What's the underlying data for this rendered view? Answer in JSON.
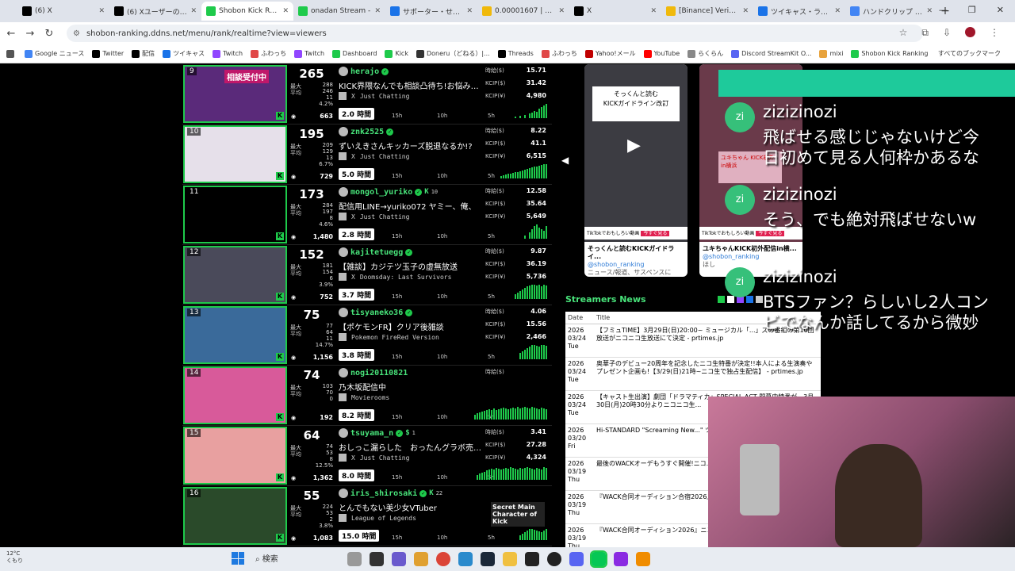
{
  "browser": {
    "tabs": [
      {
        "title": "(6) X",
        "favicon": "x-icon",
        "color": "#000000"
      },
      {
        "title": "(6) Xユーザーのにこ",
        "favicon": "x-icon",
        "color": "#000000"
      },
      {
        "title": "Shobon Kick Rank",
        "favicon": "sparkle-icon",
        "color": "#1eca4b",
        "active": true
      },
      {
        "title": "onadan Stream -",
        "favicon": "kick-icon",
        "color": "#1eca4b"
      },
      {
        "title": "サポーター・せんろ",
        "favicon": "globe-icon",
        "color": "#1a73e8"
      },
      {
        "title": "0.00001607 | AXS",
        "favicon": "coin-icon",
        "color": "#f0b90b"
      },
      {
        "title": "X",
        "favicon": "x-icon",
        "color": "#000000"
      },
      {
        "title": "[Binance] Verificati",
        "favicon": "binance-icon",
        "color": "#f0b90b"
      },
      {
        "title": "ツイキャス・ライブ",
        "favicon": "twitcasting-icon",
        "color": "#1a73e8"
      },
      {
        "title": "ハンドクリップ - Go",
        "favicon": "google-icon",
        "color": "#4285f4"
      }
    ],
    "url": "shobon-ranking.ddns.net/menu/rank/realtime?view=viewers",
    "bookmarks": [
      {
        "label": "",
        "color": "#555555"
      },
      {
        "label": "Google ニュース",
        "color": "#4285f4"
      },
      {
        "label": "Twitter",
        "color": "#000000"
      },
      {
        "label": "配信",
        "color": "#000000"
      },
      {
        "label": "ツイキャス",
        "color": "#1a73e8"
      },
      {
        "label": "Twitch",
        "color": "#9146ff"
      },
      {
        "label": "ふわっち",
        "color": "#e04848"
      },
      {
        "label": "Twitch",
        "color": "#9146ff"
      },
      {
        "label": "Dashboard",
        "color": "#1eca4b"
      },
      {
        "label": "Kick",
        "color": "#1eca4b"
      },
      {
        "label": "Doneru（どねる）|...",
        "color": "#333333"
      },
      {
        "label": "Threads",
        "color": "#000000"
      },
      {
        "label": "ふわっち",
        "color": "#e04848"
      },
      {
        "label": "Yahoo!メール",
        "color": "#c00000"
      },
      {
        "label": "YouTube",
        "color": "#ff0000"
      },
      {
        "label": "らくらん",
        "color": "#888888"
      },
      {
        "label": "Discord StreamKit O...",
        "color": "#5865f2"
      },
      {
        "label": "mixi",
        "color": "#e8a33c"
      },
      {
        "label": "Shobon Kick Ranking",
        "color": "#1eca4b"
      }
    ],
    "all_bookmarks": "すべてのブックマーク"
  },
  "rows": [
    {
      "rank": "9",
      "viewers": "265",
      "max": "288",
      "avg": "246",
      "min": "11",
      "pct": "4.2%",
      "total": "663",
      "name": "herajo",
      "title": "KICK界隈なんでも相談凸待ち!お悩み、お",
      "category": "Just Chatting",
      "hours": "2.0 時間",
      "h": "15.71",
      "c": "31.42",
      "w": "4,980",
      "thumb": "#5a2a7a",
      "badge": "相談受付中",
      "bars": [
        2,
        0,
        3,
        0,
        4,
        0,
        6,
        7,
        9,
        8,
        12,
        14,
        16,
        18
      ]
    },
    {
      "rank": "10",
      "viewers": "195",
      "max": "209",
      "avg": "129",
      "min": "13",
      "pct": "6.7%",
      "total": "729",
      "name": "znk2525",
      "title": "ずいえきさんキッカーズ脱退なるか!?",
      "category": "Just Chatting",
      "hours": "5.0 時間",
      "h": "8.22",
      "c": "41.1",
      "w": "6,515",
      "thumb": "#e6e0ea",
      "bars": [
        3,
        4,
        5,
        6,
        6,
        7,
        8,
        8,
        9,
        10,
        11,
        12,
        13,
        14,
        15,
        15,
        16,
        17,
        18,
        18
      ]
    },
    {
      "rank": "11",
      "viewers": "173",
      "max": "284",
      "avg": "197",
      "min": "8",
      "pct": "4.6%",
      "total": "1,480",
      "name": "mongol_yuriko",
      "kc": "10",
      "title": "配信用LINE→yuriko072 ヤミー、俺、",
      "category": "Just Chatting",
      "hours": "2.8 時間",
      "h": "12.58",
      "c": "35.64",
      "w": "5,649",
      "thumb": "#000000",
      "bars": [
        4,
        0,
        8,
        12,
        16,
        18,
        14,
        12,
        10,
        16
      ]
    },
    {
      "rank": "12",
      "viewers": "152",
      "max": "181",
      "avg": "154",
      "min": "6",
      "pct": "3.9%",
      "total": "752",
      "name": "kajitetuegg",
      "title": "【雑談】カジテツ玉子の虚無放送",
      "category": "Doomsday: Last Survivors",
      "hours": "3.7 時間",
      "h": "9.87",
      "c": "36.19",
      "w": "5,736",
      "thumb": "#4a4a5a",
      "bars": [
        6,
        8,
        10,
        12,
        14,
        16,
        17,
        18,
        18,
        17,
        18,
        16,
        18,
        17
      ]
    },
    {
      "rank": "13",
      "viewers": "75",
      "max": "77",
      "avg": "64",
      "min": "11",
      "pct": "14.7%",
      "total": "1,156",
      "name": "tisyaneko36",
      "title": "【ポケモンFR】クリア後雑談",
      "category": "Pokemon FireRed Version",
      "hours": "3.8 時間",
      "h": "4.06",
      "c": "15.56",
      "w": "2,466",
      "thumb": "#3a6a9a",
      "bars": [
        8,
        10,
        12,
        14,
        16,
        18,
        18,
        17,
        16,
        18,
        18,
        17
      ]
    },
    {
      "rank": "14",
      "viewers": "74",
      "max": "103",
      "avg": "70",
      "min": "0",
      "pct": "",
      "total": "192",
      "name": "nogi20110821",
      "title": "乃木坂配信中",
      "category": "Movierooms",
      "hours": "8.2 時間",
      "h": "",
      "c": "",
      "w": "",
      "thumb": "#d85a9a",
      "bars": [
        6,
        8,
        9,
        10,
        11,
        12,
        13,
        12,
        14,
        12,
        13,
        14,
        15,
        14,
        13,
        14,
        15,
        14,
        16,
        14,
        15,
        16,
        15,
        14,
        16,
        15,
        14,
        13,
        15,
        14,
        13
      ]
    },
    {
      "rank": "15",
      "viewers": "64",
      "max": "74",
      "avg": "53",
      "min": "8",
      "pct": "12.5%",
      "total": "1,362",
      "name": "tsuyama_n",
      "sc": "1",
      "title": "おしっこ漏らした　おったんグラボ売って",
      "category": "Just Chatting",
      "hours": "8.0 時間",
      "h": "3.41",
      "c": "27.28",
      "w": "4,324",
      "thumb": "#e8a0a0",
      "bars": [
        6,
        8,
        9,
        10,
        12,
        13,
        14,
        13,
        15,
        14,
        13,
        14,
        15,
        14,
        16,
        15,
        14,
        13,
        15,
        14,
        15,
        16,
        15,
        14,
        13,
        15,
        14,
        13,
        16,
        15
      ]
    },
    {
      "rank": "16",
      "viewers": "55",
      "max": "224",
      "avg": "53",
      "min": "2",
      "pct": "3.8%",
      "total": "1,083",
      "name": "iris_shirosaki",
      "kc": "22",
      "title": "とんでもない美少女VTuber",
      "category": "League of Legends",
      "hours": "15.0 時間",
      "h": "",
      "c": "",
      "w": "",
      "thumb": "#2a4a2a",
      "overlay": "Secret Main Character of Kick",
      "bars": [
        6,
        8,
        10,
        12,
        14,
        14,
        13,
        12,
        11,
        10,
        12,
        14
      ]
    }
  ],
  "labels": {
    "max": "最大",
    "avg": "平均",
    "kh": "時給($)",
    "kc": "KCIP($)",
    "kw": "KCIP(¥)",
    "t15": "15h",
    "t10": "10h",
    "t5": "5h"
  },
  "social": [
    {
      "caption1": "そっくんと読むKICKガイドライ...",
      "caption2": "@shobon_ranking",
      "caption3": "ニュース/報道、サスペンスに",
      "inner": "KICKガイドライン改訂",
      "inner_top": "そっくんと読む"
    },
    {
      "caption1": "ユキちゃんKICK初外配信in横...",
      "caption2": "@shobon_ranking",
      "caption3": "ほし",
      "inner": "ユキちゃん KICK初外 in横浜"
    }
  ],
  "news": {
    "heading": "Streamers News",
    "col_date": "Date",
    "col_title": "Title",
    "items": [
      {
        "y": "2026",
        "md": "03/24",
        "dw": "Tue",
        "text": "【フミュTIME】3月29日(日)20:00~ ミュージカル「...」ズの番組の第10回放送がニコニコ生放送にて決定 - prtimes.jp"
      },
      {
        "y": "2026",
        "md": "03/24",
        "dw": "Tue",
        "text": "奥華子のデビュー20周年を記念したニコ生特番が決定!!本人による生演奏やプレゼント企画も!【3/29(日)21時~ニコ生で独占生配信】 - prtimes.jp"
      },
      {
        "y": "2026",
        "md": "03/24",
        "dw": "Tue",
        "text": "【キャスト生出演】劇団「ドラマティカ」SPECIAL ACT 開幕中特番が、3月30日(月)20時30分よりニコニコ生..."
      },
      {
        "y": "2026",
        "md": "03/20",
        "dw": "Fri",
        "text": "Hi-STANDARD \"Screaming New...\" ツアーファイナル公演の生中継がニコ..."
      },
      {
        "y": "2026",
        "md": "03/19",
        "dw": "Thu",
        "text": "最後のWACKオーデもうすぐ開催!ニコ... ニュース"
      },
      {
        "y": "2026",
        "md": "03/19",
        "dw": "Thu",
        "text": "『WACK合同オーディション合宿2026』(日)13:00から全編生中継決定。"
      },
      {
        "y": "2026",
        "md": "03/19",
        "dw": "Thu",
        "text": "『WACK合同オーディション2026』ニコ... skream.jp"
      }
    ]
  },
  "chat": [
    {
      "initials": "zi",
      "user": "zizizinozi",
      "msg1": "飛ばせる感じじゃないけど今",
      "msg2": "日初めて見る人何枠かあるな"
    },
    {
      "initials": "zi",
      "user": "zizizinozi",
      "msg1": "そう、でも絶対飛ばせないw",
      "msg2": ""
    },
    {
      "initials": "zi",
      "user": "zizizinozi",
      "msg1": "BTSファン？らしいし2人コン",
      "msg2": "ビでなんか話してるから微妙"
    }
  ],
  "taskbar": {
    "temp": "12°C",
    "cond": "くもり",
    "search": "検索"
  }
}
